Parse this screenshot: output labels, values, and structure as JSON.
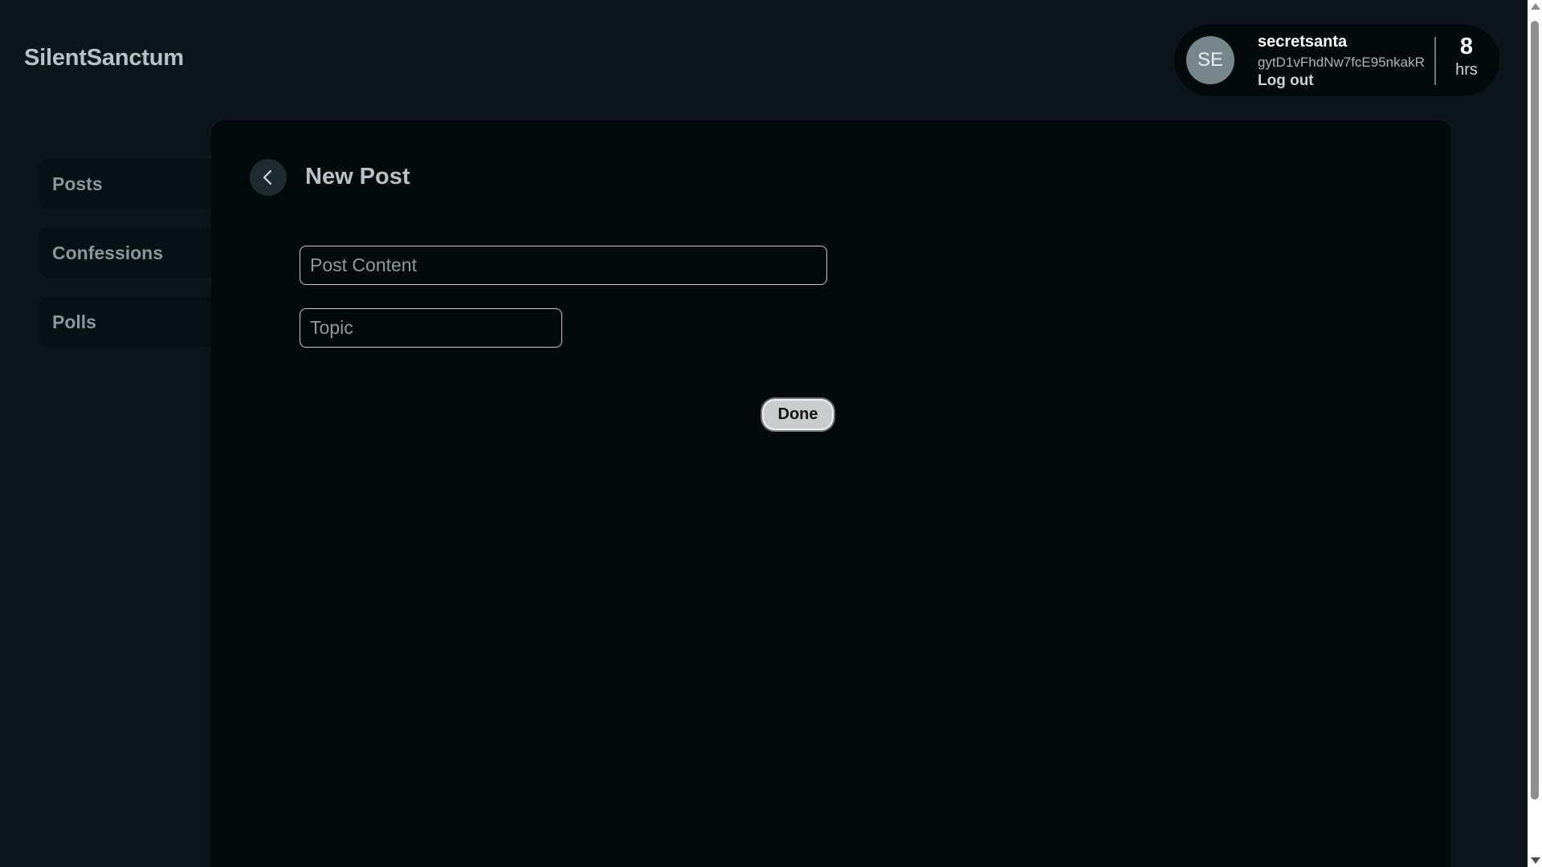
{
  "app": {
    "brand": "SilentSanctum"
  },
  "user": {
    "initials": "SE",
    "username": "secretsanta",
    "user_id": "gytD1vFhdNw7fcE95nkakR",
    "logout_label": "Log out",
    "hours_value": "8",
    "hours_unit": "hrs"
  },
  "sidebar": {
    "items": [
      {
        "label": "Posts"
      },
      {
        "label": "Confessions"
      },
      {
        "label": "Polls"
      }
    ]
  },
  "main": {
    "title": "New Post",
    "form": {
      "post_content": {
        "value": "",
        "placeholder": "Post Content"
      },
      "topic": {
        "value": "",
        "placeholder": "Topic"
      },
      "done_label": "Done"
    }
  },
  "icons": {
    "back": "chevron-left-icon",
    "scroll_up": "triangle-up-icon",
    "scroll_down": "triangle-down-icon"
  },
  "colors": {
    "page_background": "#0c161a",
    "panel_background": "#030a0b",
    "avatar": "#76868b",
    "done_button": "#c9cccd"
  }
}
